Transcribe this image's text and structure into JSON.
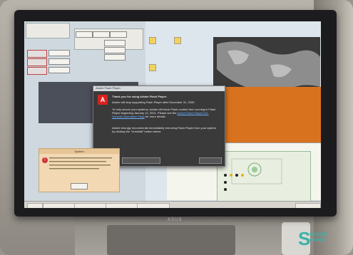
{
  "flash_dialog": {
    "window_title": "Adobe Flash Player",
    "logo_letter": "A",
    "line1": "Thank you for using Adobe Flash Player.",
    "line2": "Adobe will stop supporting Flash Player after December 31, 2020.",
    "line3": "To help secure your systems, Adobe will block Flash content from running in Flash Player beginning January 12, 2021. Please see the",
    "link": "Adobe Flash Player EOL General Information Page",
    "line3_end": "for more details.",
    "line4": "Adobe strongly recommends immediately removing Flash Player from your system by clicking the \"Uninstall\" button below.",
    "button_left": "",
    "button_right": ""
  },
  "popup": {
    "title": "System",
    "icon": "error-icon"
  },
  "monitor": {
    "brand": "ASUS"
  },
  "watermark": {
    "line1": "SECOND",
    "line2": "OWNER"
  },
  "colors": {
    "adobe_red": "#d7231e",
    "dialog_bg": "#3a3a3a",
    "orange_region": "#d9721e",
    "watermark_teal": "#3bb3a8"
  }
}
